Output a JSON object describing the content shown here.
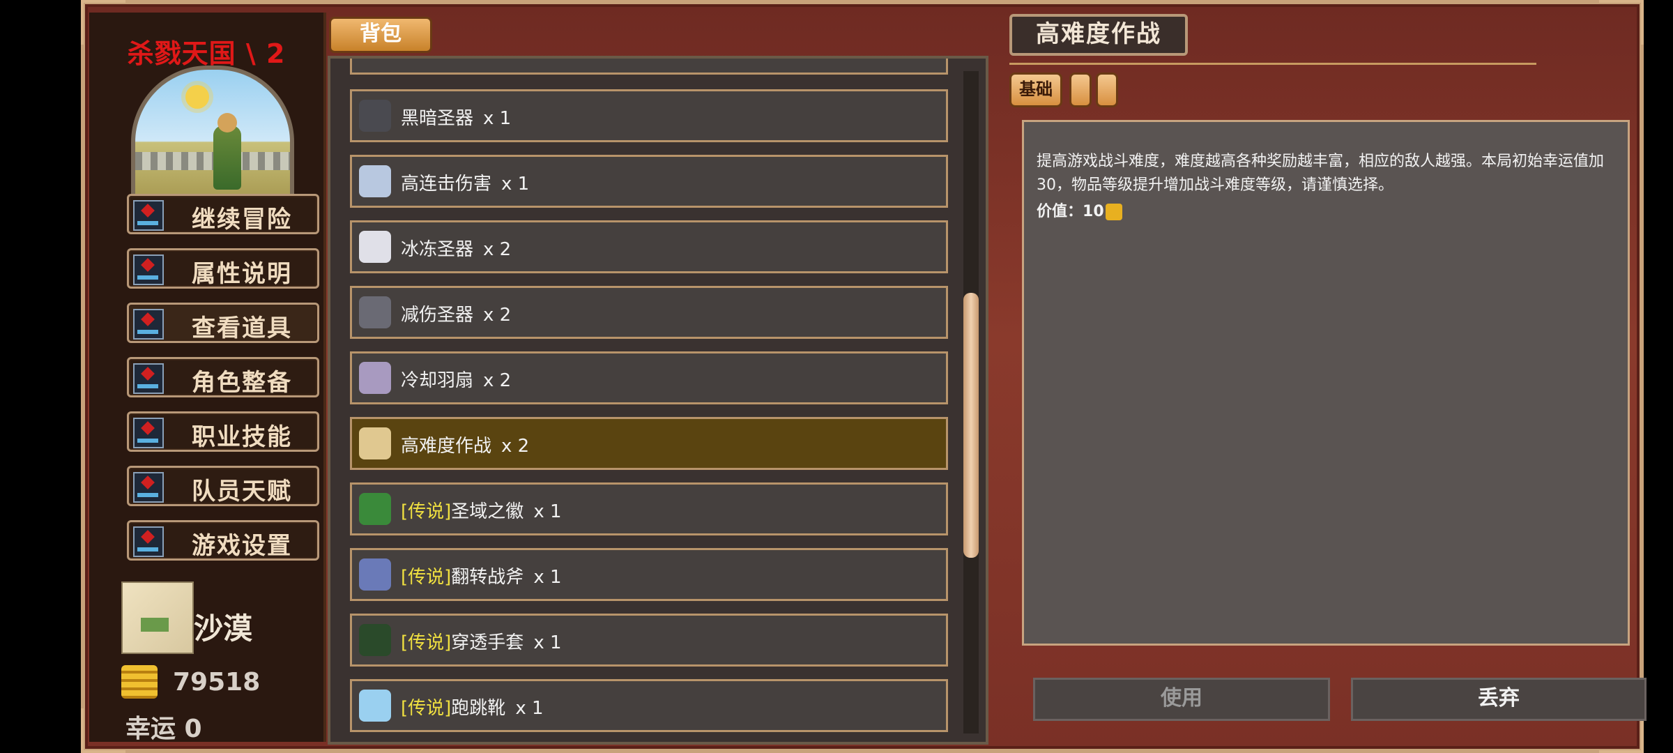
{
  "sidebar": {
    "game_title": "杀戮天国 \\ 2",
    "menu": [
      {
        "label": "继续冒险"
      },
      {
        "label": "属性说明"
      },
      {
        "label": "查看道具"
      },
      {
        "label": "角色整备"
      },
      {
        "label": "职业技能"
      },
      {
        "label": "队员天赋"
      },
      {
        "label": "游戏设置"
      }
    ],
    "zone_name": "沙漠",
    "gold": "79518",
    "luck": "幸运 0"
  },
  "inventory": {
    "tab_label": "背包",
    "items": [
      {
        "tag": "",
        "name": "黑暗圣器",
        "count": "x 1",
        "icon": "dark-relic-icon"
      },
      {
        "tag": "",
        "name": "高连击伤害",
        "count": "x 1",
        "icon": "combo-damage-icon"
      },
      {
        "tag": "",
        "name": "冰冻圣器",
        "count": "x 2",
        "icon": "frost-relic-icon"
      },
      {
        "tag": "",
        "name": "减伤圣器",
        "count": "x 2",
        "icon": "damage-reduction-relic-icon"
      },
      {
        "tag": "",
        "name": "冷却羽扇",
        "count": "x 2",
        "icon": "cooldown-fan-icon"
      },
      {
        "tag": "",
        "name": "高难度作战",
        "count": "x 2",
        "icon": "scroll-icon",
        "selected": true
      },
      {
        "tag": "[传说]",
        "name": "圣域之徽",
        "count": "x 1",
        "icon": "amulet-icon"
      },
      {
        "tag": "[传说]",
        "name": "翻转战斧",
        "count": "x 1",
        "icon": "battle-axe-icon"
      },
      {
        "tag": "[传说]",
        "name": "穿透手套",
        "count": "x 1",
        "icon": "gauntlet-icon"
      },
      {
        "tag": "[传说]",
        "name": "跑跳靴",
        "count": "x 1",
        "icon": "boots-icon"
      }
    ]
  },
  "detail": {
    "title": "高难度作战",
    "subtab_base": "基础",
    "description": "提高游戏战斗难度，难度越高各种奖励越丰富，相应的敌人越强。本局初始幸运值加30，物品等级提升增加战斗难度等级，请谨慎选择。",
    "value_label": "价值：",
    "value": "10",
    "use_label": "使用",
    "drop_label": "丢弃"
  },
  "colors": {
    "title_red": "#e01818",
    "legend_yellow": "#f0e040",
    "selected_row": "#5a4410",
    "frame_red": "#8a3a2c"
  }
}
